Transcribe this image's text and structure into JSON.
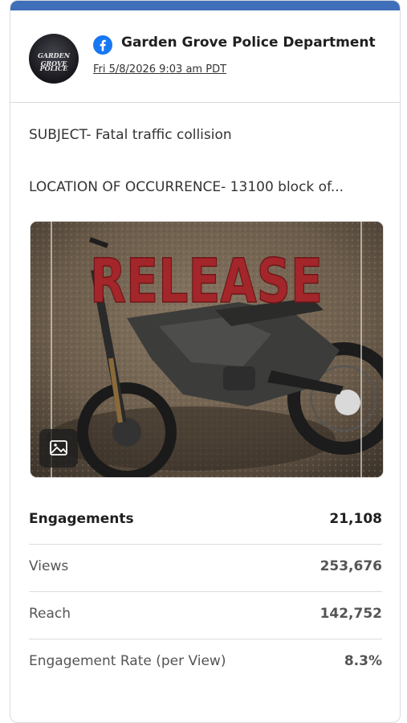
{
  "colors": {
    "accent_bar": "#3f6fb8",
    "facebook_blue": "#1877f2",
    "release_red": "#a3262a"
  },
  "post": {
    "author": "Garden Grove Police Department",
    "network_icon": "facebook-icon",
    "timestamp": "Fri 5/8/2026 9:03 am PDT",
    "avatar_text_top": "GARDEN GROVE",
    "avatar_text_bottom": "POLICE",
    "message_lines": [
      "SUBJECT- Fatal traffic collision",
      "LOCATION OF OCCURRENCE- 13100 block of..."
    ],
    "image_overlay_text": "RELEASE",
    "image_badge_icon": "image-icon"
  },
  "stats": [
    {
      "label": "Engagements",
      "value": "21,108"
    },
    {
      "label": "Views",
      "value": "253,676"
    },
    {
      "label": "Reach",
      "value": "142,752"
    },
    {
      "label": "Engagement Rate (per View)",
      "value": "8.3%"
    }
  ]
}
